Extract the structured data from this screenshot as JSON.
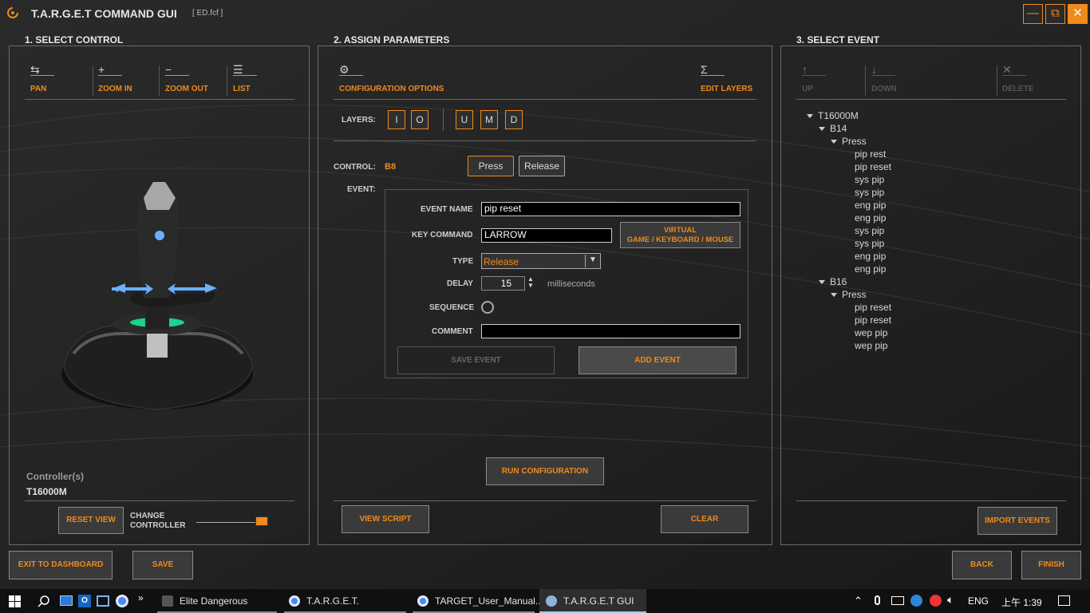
{
  "app": {
    "title": "T.A.R.G.E.T COMMAND GUI",
    "file": "[ ED.fcf ]"
  },
  "window_controls": {
    "minimize": "—",
    "restore": "⧉",
    "close": "✕"
  },
  "colors": {
    "accent": "#f08a1c",
    "background": "#1b1b1b",
    "panel_border": "#6a6a6a",
    "field_bg": "#000000"
  },
  "sections": {
    "select_control": "1. SELECT CONTROL",
    "assign_parameters": "2. ASSIGN PARAMETERS",
    "select_event": "3. SELECT EVENT"
  },
  "control_panel": {
    "tools": [
      {
        "label": "PAN",
        "icon": "pan-icon",
        "glyph": "⇆"
      },
      {
        "label": "ZOOM IN",
        "icon": "zoom-in-icon",
        "glyph": "+"
      },
      {
        "label": "ZOOM OUT",
        "icon": "zoom-out-icon",
        "glyph": "−"
      },
      {
        "label": "LIST",
        "icon": "list-icon",
        "glyph": "☰"
      }
    ],
    "controllers_label": "Controller(s)",
    "controller": "T16000M",
    "reset_view": "RESET VIEW",
    "change_controller": "CHANGE CONTROLLER"
  },
  "params": {
    "config_options": "CONFIGURATION OPTIONS",
    "config_glyph": "⚙",
    "edit_layers": "EDIT LAYERS",
    "edit_layers_glyph": "Σ",
    "layers_label": "LAYERS:",
    "layers_a": [
      "I",
      "O"
    ],
    "layers_b": [
      "U",
      "M",
      "D"
    ],
    "control_label": "CONTROL:",
    "control_value": "B8",
    "press": "Press",
    "release": "Release",
    "event_label": "EVENT:",
    "event_name_label": "EVENT NAME",
    "event_name_value": "pip reset",
    "key_command_label": "KEY COMMAND",
    "key_command_value": "LARROW",
    "virtual_button": "VIRTUAL\nGAME / KEYBOARD / MOUSE",
    "type_label": "TYPE",
    "type_value": "Release",
    "delay_label": "DELAY",
    "delay_value": "15",
    "delay_unit": "milliseconds",
    "sequence_label": "SEQUENCE",
    "comment_label": "COMMENT",
    "comment_value": "",
    "save_event": "SAVE EVENT",
    "add_event": "ADD EVENT",
    "run_configuration": "RUN CONFIGURATION",
    "view_script": "VIEW SCRIPT",
    "clear": "CLEAR"
  },
  "events_panel": {
    "tools": [
      {
        "label": "UP",
        "icon": "arrow-up-icon",
        "glyph": "↑"
      },
      {
        "label": "DOWN",
        "icon": "arrow-down-icon",
        "glyph": "↓"
      },
      {
        "label": "DELETE",
        "icon": "delete-icon",
        "glyph": "✕"
      }
    ],
    "tree": {
      "root": "T16000M",
      "groups": [
        {
          "button": "B14",
          "action": "Press",
          "events": [
            "pip rest",
            "pip reset",
            "sys pip",
            "sys pip",
            "eng pip",
            "eng pip",
            "sys pip",
            "sys pip",
            "eng pip",
            "eng pip"
          ]
        },
        {
          "button": "B16",
          "action": "Press",
          "events": [
            "pip reset",
            "pip reset",
            "wep pip",
            "wep pip"
          ]
        }
      ]
    },
    "import_events": "IMPORT EVENTS"
  },
  "footer": {
    "exit": "EXIT TO DASHBOARD",
    "save": "SAVE",
    "back": "BACK",
    "finish": "FINISH"
  },
  "taskbar": {
    "apps": [
      {
        "label": "Elite Dangerous Laun...",
        "icon": "elite-dangerous-icon",
        "color": "#666666"
      },
      {
        "label": "T.A.R.G.E.T. Thrustma...",
        "icon": "chrome-icon",
        "color": "#4a8af4"
      },
      {
        "label": "TARGET_User_Manual...",
        "icon": "chrome-icon",
        "color": "#4a8af4"
      },
      {
        "label": "T.A.R.G.E.T GUI",
        "icon": "target-gui-icon",
        "color": "#8ab4d8"
      }
    ],
    "lang": "ENG",
    "time": "上午 1:39"
  }
}
